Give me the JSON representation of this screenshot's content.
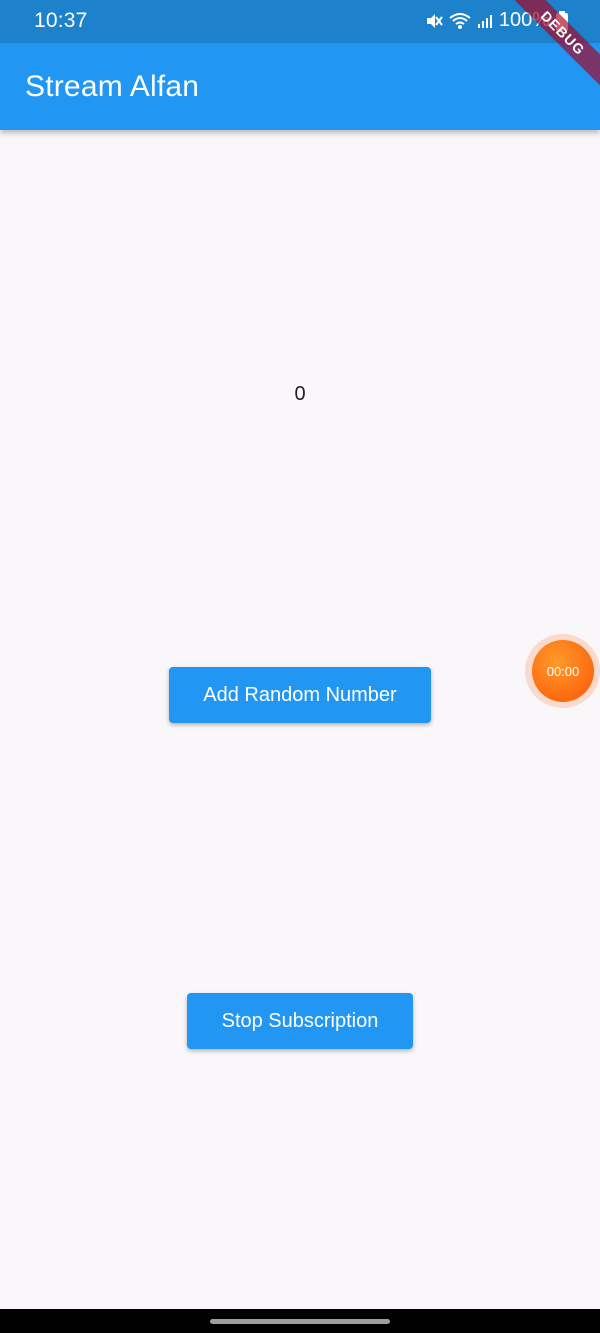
{
  "status_bar": {
    "time": "10:37",
    "battery": "100%",
    "icons": [
      "mute-icon",
      "wifi-icon",
      "signal-icon",
      "battery-icon"
    ]
  },
  "app_bar": {
    "title": "Stream Alfan",
    "color": "#2196f3"
  },
  "debug_banner": {
    "label": "DEBUG"
  },
  "main": {
    "counter_value": "0",
    "add_button_label": "Add Random Number",
    "stop_button_label": "Stop Subscription"
  },
  "recorder_overlay": {
    "timer": "00:00",
    "color": "#fb6a10"
  }
}
